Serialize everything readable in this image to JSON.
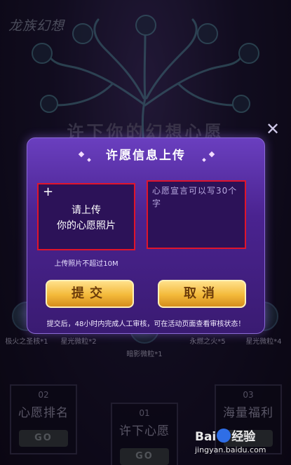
{
  "background": {
    "logo": "龙族幻想",
    "wish_title": "许下你的幻想心愿",
    "close_symbol": "✕",
    "rewards": [
      {
        "label": "极火之圣核*1"
      },
      {
        "label": "星光微粒*2"
      },
      {
        "label": "暗影微粒*1"
      },
      {
        "label": "永燃之火*5"
      },
      {
        "label": "星光微粒*4"
      }
    ],
    "nav_cards": [
      {
        "num": "02",
        "title": "心愿排名",
        "go": "GO"
      },
      {
        "num": "01",
        "title": "许下心愿",
        "go": "GO"
      },
      {
        "num": "03",
        "title": "海量福利",
        "go": "GO"
      }
    ]
  },
  "modal": {
    "title": "许愿信息上传",
    "upload": {
      "plus": "+",
      "line1": "请上传",
      "line2": "你的心愿照片",
      "hint": "上传照片不超过10M"
    },
    "wish_placeholder": "心愿宣言可以写30个字",
    "submit_label": "提交",
    "cancel_label": "取消",
    "note": "提交后，48小时内完成人工审核，可在活动页面查看审核状态！",
    "highlight_color": "#e0142b"
  },
  "watermark": {
    "brand_left": "Bai",
    "brand_right": "经验",
    "url": "jingyan.baidu.com"
  }
}
